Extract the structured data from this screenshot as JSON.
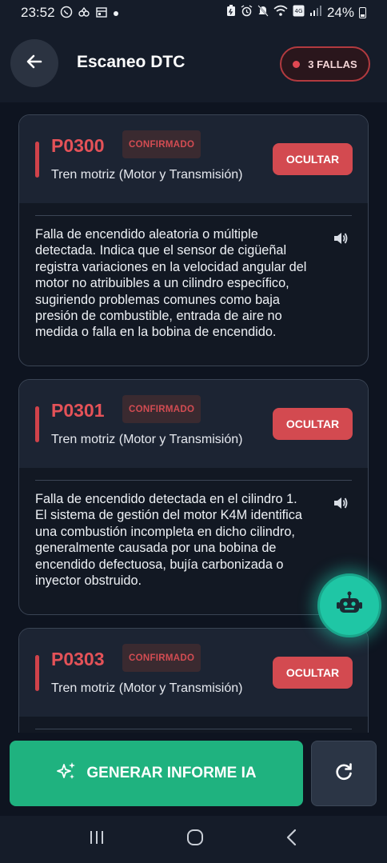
{
  "status_bar": {
    "time": "23:52",
    "battery_percent": "24%",
    "left_icons": [
      "whatsapp-icon",
      "sync-icon",
      "calendar-icon",
      "dot-icon"
    ],
    "right_icons": [
      "battery-saver-icon",
      "alarm-icon",
      "mute-icon",
      "wifi-icon",
      "volte-icon",
      "signal-icon",
      "battery-icon"
    ]
  },
  "header": {
    "title": "Escaneo DTC",
    "fail_badge": "3 FALLAS"
  },
  "dtc_cards": [
    {
      "code": "P0300",
      "status": "CONFIRMADO",
      "system": "Tren motriz (Motor y Transmisión)",
      "hide_label": "OCULTAR",
      "description": "Falla de encendido aleatoria o múltiple detectada. Indica que el sensor de cigüeñal registra variaciones en la velocidad angular del motor no atribuibles a un cilindro específico, sugiriendo problemas comunes como baja presión de combustible, entrada de aire no medida o falla en la bobina de encendido."
    },
    {
      "code": "P0301",
      "status": "CONFIRMADO",
      "system": "Tren motriz (Motor y Transmisión)",
      "hide_label": "OCULTAR",
      "description": "Falla de encendido detectada en el cilindro 1. El sistema de gestión del motor K4M identifica una combustión incompleta en dicho cilindro, generalmente causada por una bobina de encendido defectuosa, bujía carbonizada o inyector obstruido."
    },
    {
      "code": "P0303",
      "status": "CONFIRMADO",
      "system": "Tren motriz (Motor y Transmisión)",
      "hide_label": "OCULTAR",
      "description": ""
    }
  ],
  "actions": {
    "generate_label": "GENERAR INFORME IA"
  },
  "colors": {
    "background": "#0e1420",
    "card_header": "#1c2433",
    "danger": "#d34a50",
    "accent_green": "#1fb27f",
    "fab_teal": "#1fc6a5"
  }
}
